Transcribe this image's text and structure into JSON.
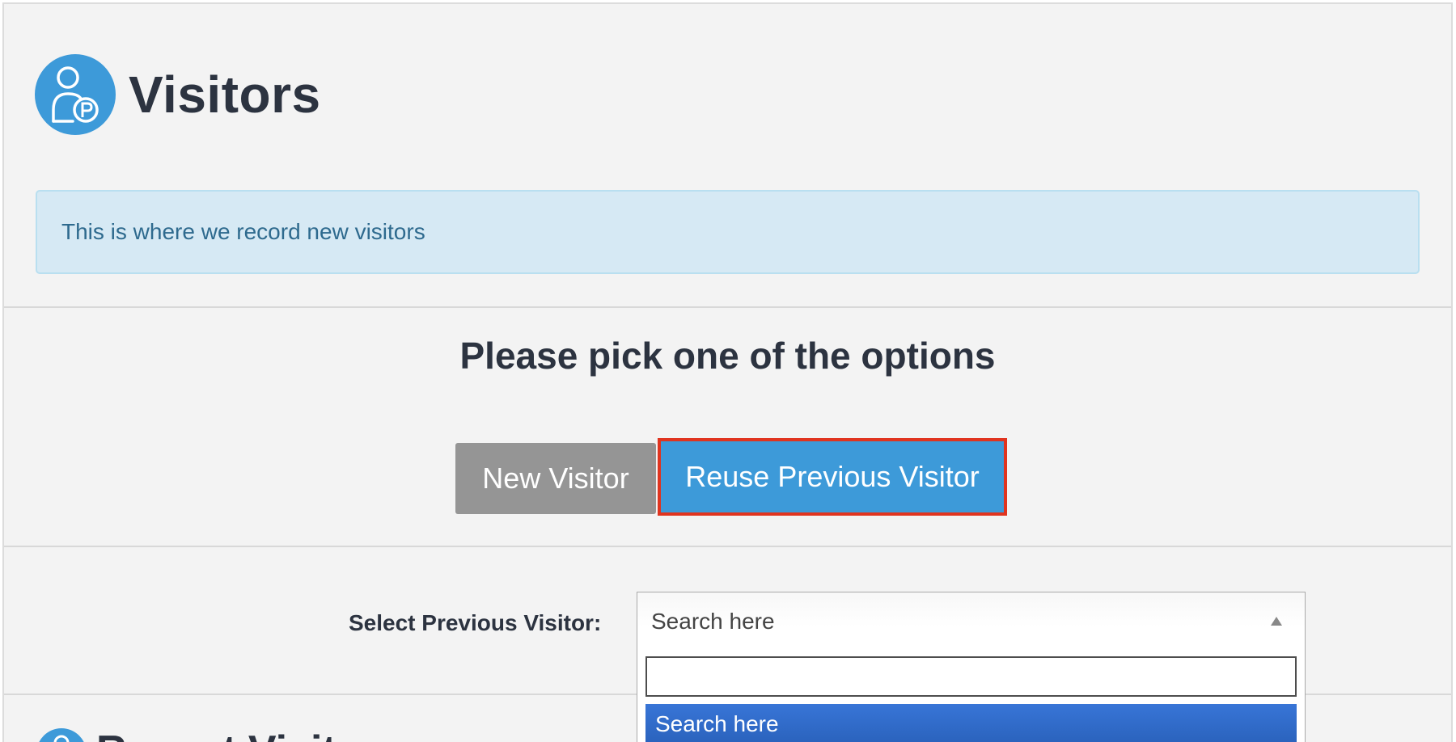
{
  "header": {
    "title": "Visitors",
    "icon": "visitor-parking-icon"
  },
  "alert": {
    "text": "This is where we record new visitors"
  },
  "options": {
    "heading": "Please pick one of the options",
    "new_visitor_label": "New Visitor",
    "reuse_visitor_label": "Reuse Previous Visitor"
  },
  "select": {
    "label": "Select Previous Visitor:",
    "value": "Search here",
    "search_input_value": "",
    "options": [
      "Search here"
    ]
  },
  "recent": {
    "title": "Recent Visitors"
  },
  "colors": {
    "accent": "#3d9ad9",
    "highlight_border": "#e0341f",
    "alert_bg": "#d6e9f4",
    "option_selected": "#3875d7",
    "button_gray": "#959595"
  }
}
